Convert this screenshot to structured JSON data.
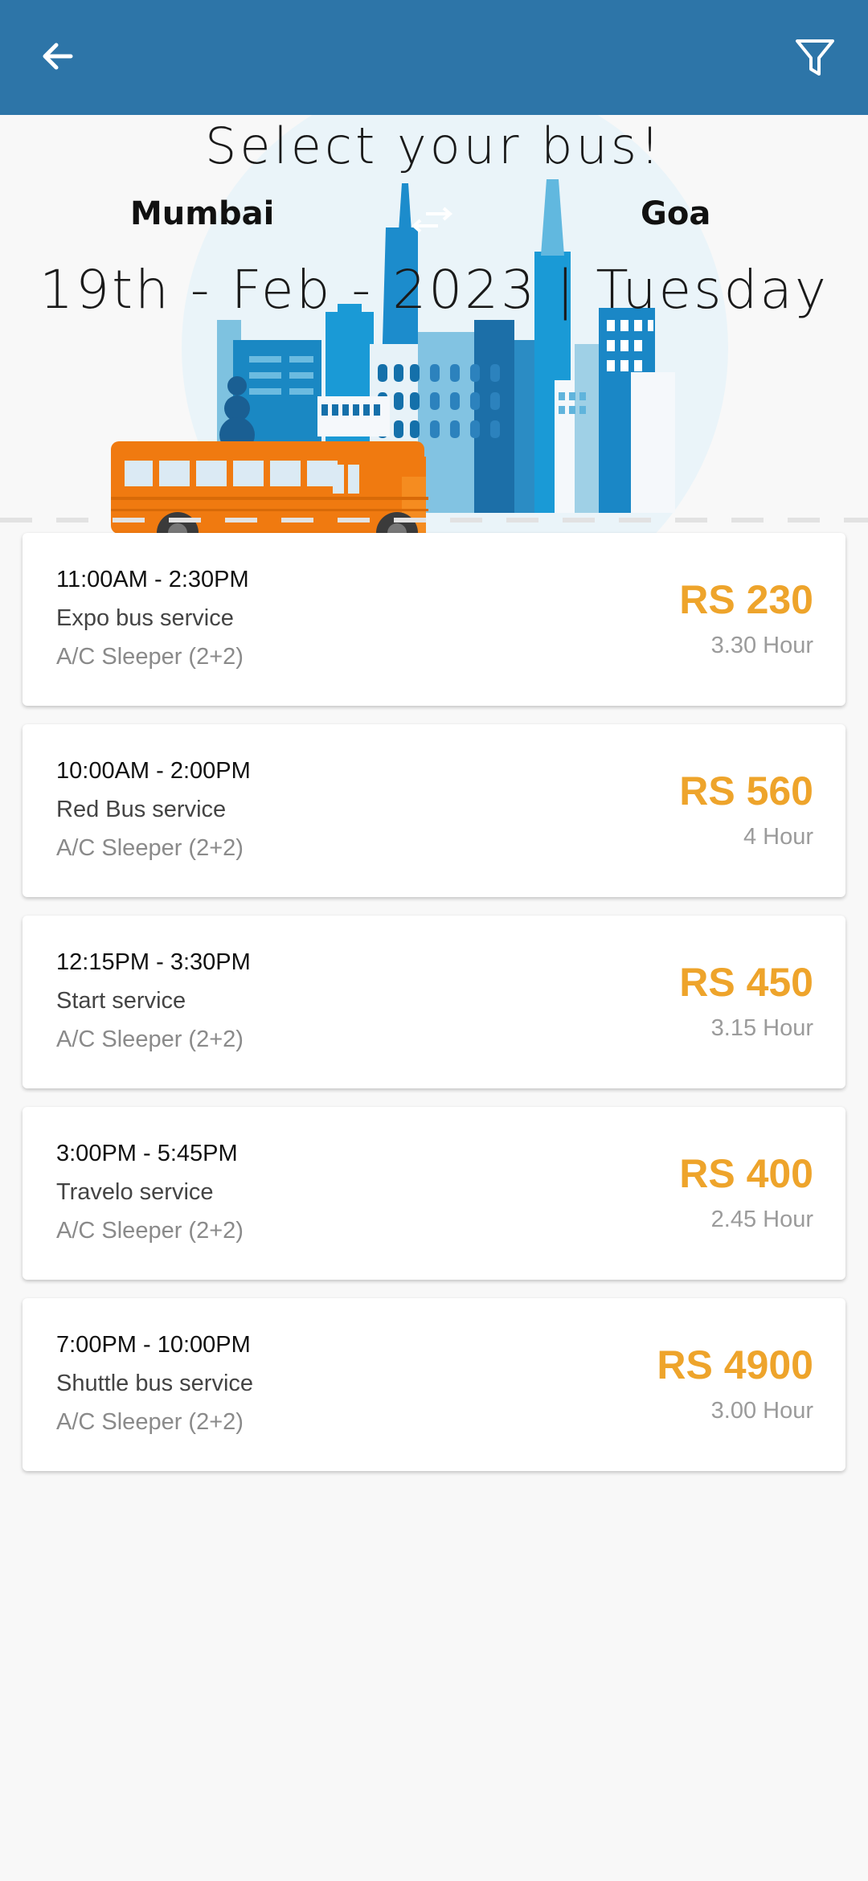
{
  "header": {
    "back_icon": "arrow-left-icon",
    "filter_icon": "filter-icon",
    "background_color": "#2d75a8"
  },
  "hero": {
    "title": "Select your bus!",
    "from_city": "Mumbai",
    "to_city": "Goa",
    "date": "19th - Feb - 2023 | Tuesday"
  },
  "buses": [
    {
      "time": "11:00AM - 2:30PM",
      "name": "Expo bus service",
      "type": "A/C Sleeper (2+2)",
      "price": "RS 230",
      "duration": "3.30 Hour"
    },
    {
      "time": "10:00AM - 2:00PM",
      "name": "Red Bus service",
      "type": "A/C Sleeper (2+2)",
      "price": "RS 560",
      "duration": "4 Hour"
    },
    {
      "time": "12:15PM - 3:30PM",
      "name": "Start service",
      "type": "A/C Sleeper (2+2)",
      "price": "RS 450",
      "duration": "3.15 Hour"
    },
    {
      "time": "3:00PM - 5:45PM",
      "name": "Travelo service",
      "type": "A/C Sleeper (2+2)",
      "price": "RS 400",
      "duration": "2.45 Hour"
    },
    {
      "time": "7:00PM - 10:00PM",
      "name": "Shuttle bus service",
      "type": "A/C Sleeper (2+2)",
      "price": "RS 4900",
      "duration": "3.00 Hour"
    }
  ],
  "colors": {
    "price": "#eea42b",
    "bus": "#f07a10"
  }
}
